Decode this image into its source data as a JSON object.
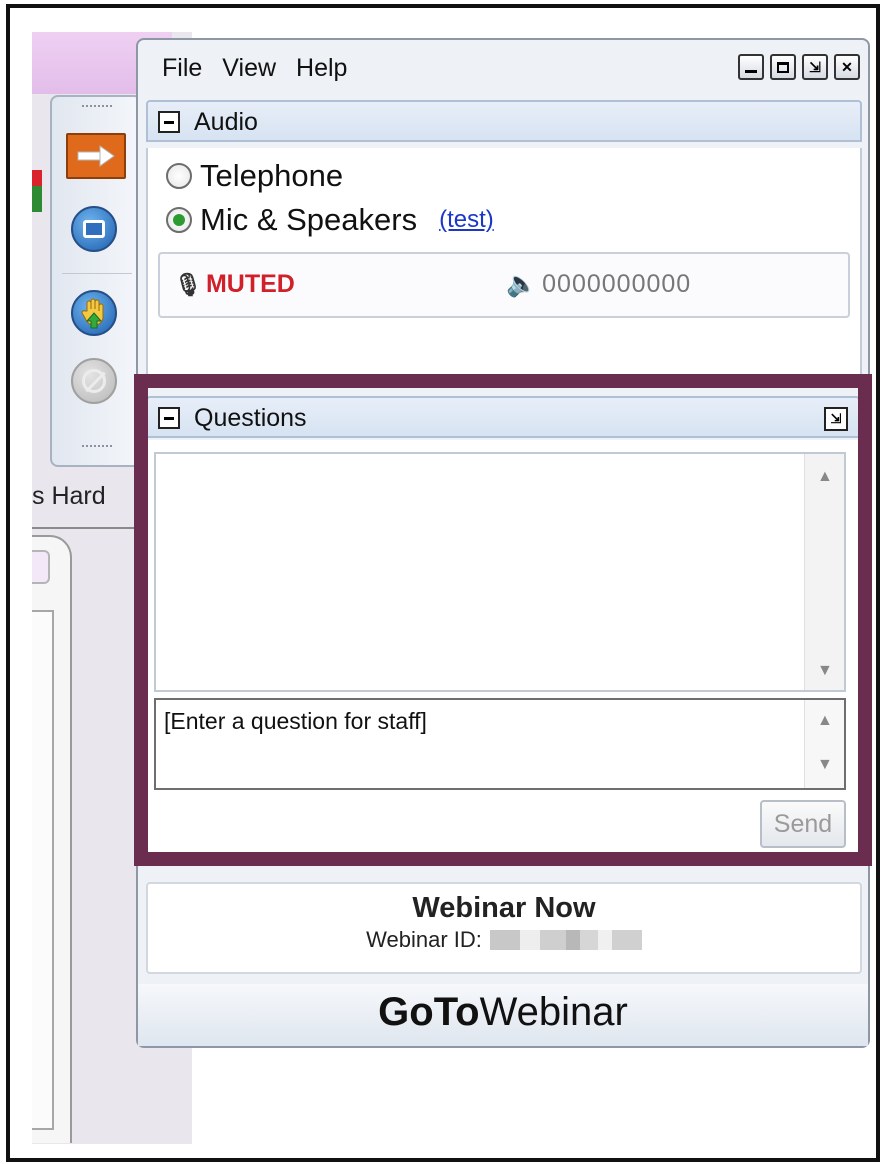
{
  "background_app": {
    "partial_text": "s Hard ",
    "colors": {
      "titlebar": "#e6c3ec",
      "red_tab": "#d9242b",
      "green_tab": "#2e8b34"
    }
  },
  "toolbar": {
    "buttons": [
      {
        "name": "show-hide-panel",
        "icon": "arrow-right-icon"
      },
      {
        "name": "full-screen",
        "icon": "window-icon"
      },
      {
        "name": "raise-hand",
        "icon": "hand-icon"
      },
      {
        "name": "disabled-action",
        "icon": "disabled-icon"
      }
    ]
  },
  "window": {
    "menu": [
      "File",
      "View",
      "Help"
    ],
    "controls": [
      "minimize",
      "maximize",
      "restore",
      "close"
    ]
  },
  "audio": {
    "title": "Audio",
    "options": [
      {
        "label": "Telephone",
        "selected": false
      },
      {
        "label": "Mic & Speakers",
        "selected": true
      }
    ],
    "test_link": "(test)",
    "mic_status": "MUTED",
    "speaker_level": "0000000000"
  },
  "questions": {
    "title": "Questions",
    "input_text": "[Enter a question for staff]",
    "send_label": "Send",
    "highlight_color": "#6b2d4f"
  },
  "webinar": {
    "name": "Webinar Now",
    "id_label": "Webinar ID:"
  },
  "brand": {
    "bold": "GoTo",
    "regular": "Webinar"
  }
}
